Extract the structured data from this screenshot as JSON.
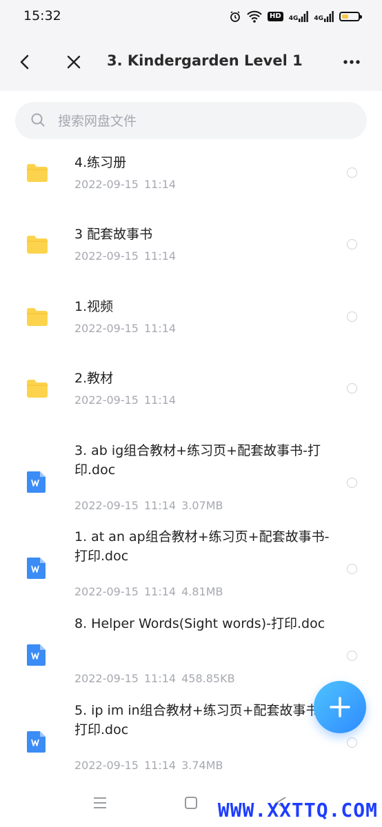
{
  "status": {
    "time": "15:32",
    "hd": "HD",
    "sig1": "4G",
    "sig2": "4G"
  },
  "header": {
    "title": "3. Kindergarden Level 1"
  },
  "search": {
    "placeholder": "搜索网盘文件"
  },
  "files": [
    {
      "type": "folder",
      "name": "4.练习册",
      "date": "2022-09-15",
      "time": "11:14",
      "size": ""
    },
    {
      "type": "folder",
      "name": "3 配套故事书",
      "date": "2022-09-15",
      "time": "11:14",
      "size": ""
    },
    {
      "type": "folder",
      "name": "1.视频",
      "date": "2022-09-15",
      "time": "11:14",
      "size": ""
    },
    {
      "type": "folder",
      "name": "2.教材",
      "date": "2022-09-15",
      "time": "11:14",
      "size": ""
    },
    {
      "type": "doc",
      "name": "3. ab ig组合教材+练习页+配套故事书-打印.doc",
      "date": "2022-09-15",
      "time": "11:14",
      "size": "3.07MB"
    },
    {
      "type": "doc",
      "name": "1. at an ap组合教材+练习页+配套故事书-打印.doc",
      "date": "2022-09-15",
      "time": "11:14",
      "size": "4.81MB"
    },
    {
      "type": "doc",
      "name": "8. Helper Words(Sight words)-打印.doc",
      "date": "2022-09-15",
      "time": "11:14",
      "size": "458.85KB"
    },
    {
      "type": "doc",
      "name": "5. ip im in组合教材+练习页+配套故事书-打印.doc",
      "date": "2022-09-15",
      "time": "11:14",
      "size": "3.74MB"
    }
  ],
  "colors": {
    "folder": "#fcd34d",
    "doc": "#3b8cf5",
    "accent": "#2e8bff"
  },
  "watermark": "WWW.XXTTQ.COM"
}
